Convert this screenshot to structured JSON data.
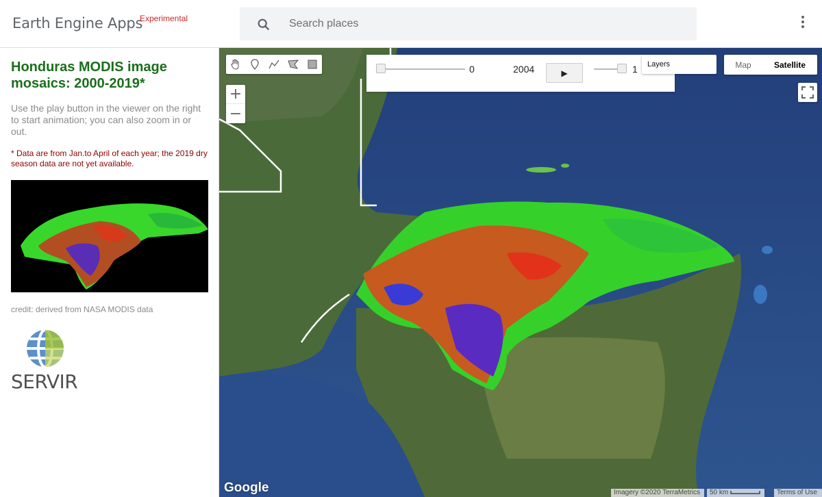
{
  "header": {
    "brand": "Earth Engine Apps",
    "badge": "Experimental",
    "search_placeholder": "Search places",
    "icons": [
      "search-icon",
      "more-vert-icon"
    ]
  },
  "panel": {
    "title": "Honduras MODIS image mosaics: 2000-2019*",
    "description": "Use the play button in the viewer on the right to start animation; you can also zoom in or out.",
    "note": "* Data are from Jan.to April of each year; the 2019 dry season data are not yet available.",
    "credit": "credit: derived from NASA MODIS data",
    "logo_text": "SERVIR",
    "colors": {
      "title": "#1b6e1b",
      "note": "#8b0000"
    }
  },
  "map": {
    "tools": [
      "hand-icon",
      "point-icon",
      "line-icon",
      "polygon-icon",
      "rectangle-icon"
    ],
    "zoom_in": "+",
    "zoom_out": "−",
    "slider_left_value": "0",
    "year": "2004",
    "play_label": "▶",
    "slider_right_value": "1",
    "layers_label": "Layers",
    "maptype_map": "Map",
    "maptype_satellite": "Satellite",
    "google": "Google",
    "imagery_credit": "Imagery ©2020 TerraMetrics",
    "scale_label": "50 km",
    "terms": "Terms of Use"
  }
}
